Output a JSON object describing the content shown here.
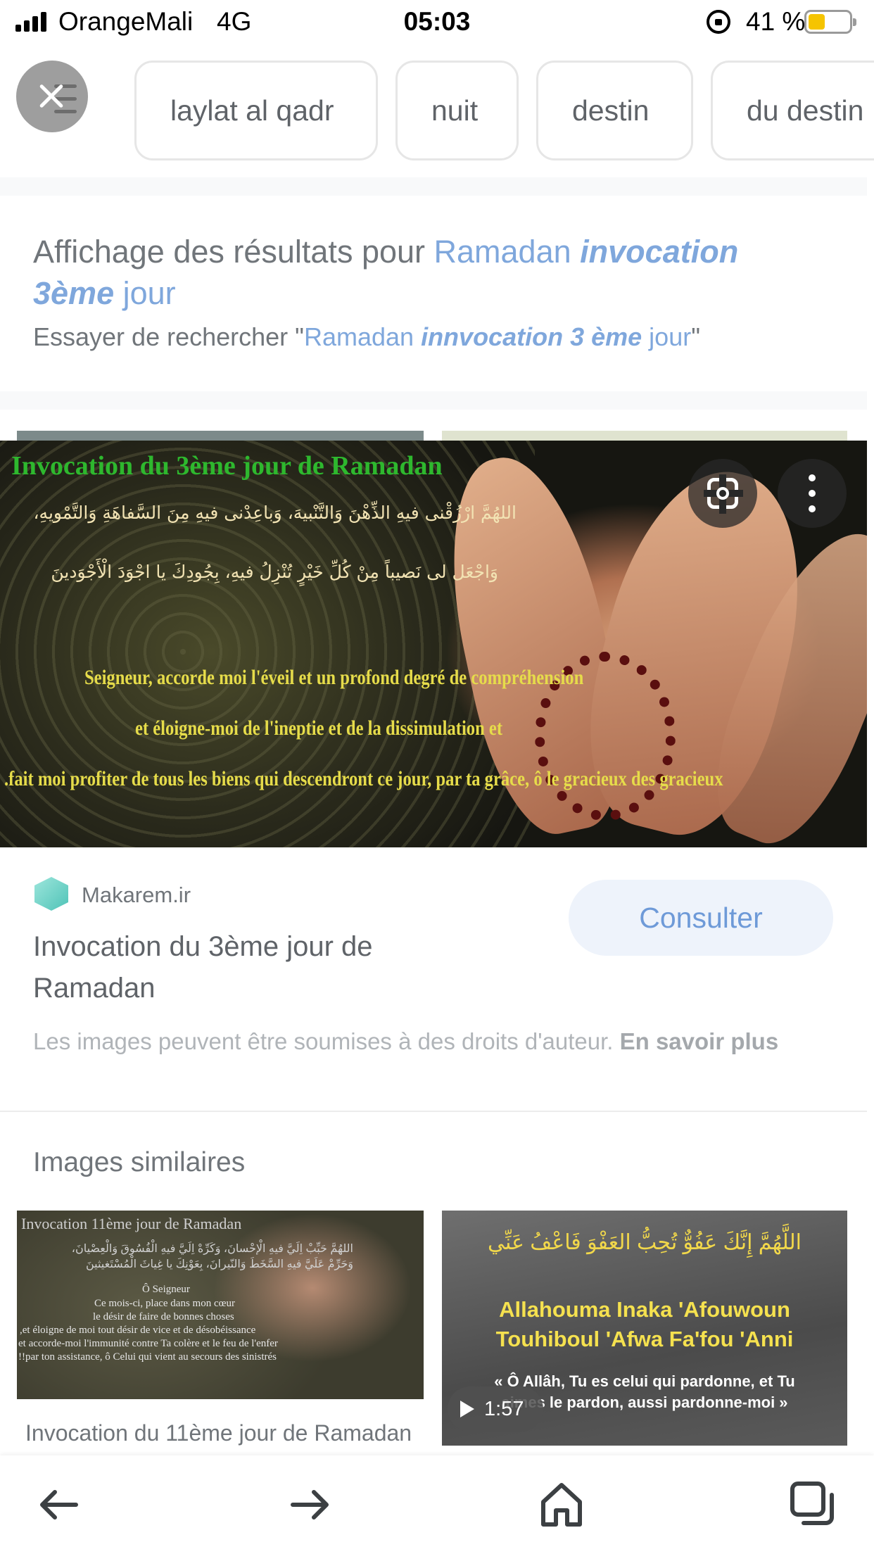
{
  "status_bar": {
    "carrier": "OrangeMali",
    "network": "4G",
    "time": "05:03",
    "battery_percent": "41 %",
    "battery_level": 0.41,
    "icons": [
      "signal-icon",
      "orientation-lock-icon",
      "battery-icon"
    ]
  },
  "chips": {
    "close_icon": "close-filter-icon",
    "items": [
      "laylat al qadr",
      "nuit",
      "destin",
      "du destin"
    ]
  },
  "results": {
    "prefix": "Affichage des résultats pour ",
    "query_word1": "Ramadan",
    "query_em1": "invocation",
    "query_em2": "3ème",
    "query_word2": "jour",
    "suggest_prefix": "Essayer de rechercher \"",
    "suggest_word1": "Ramadan",
    "suggest_em": "innvocation 3 ème",
    "suggest_word2": "jour",
    "suggest_suffix": "\""
  },
  "preview": {
    "image_title": "Invocation du 3ème jour de Ramadan",
    "arabic_line1": "اللهُمَّ ارْزُقْنى فيهِ الذِّهْنَ وَالتَّنْبيهَ، وَباعِدْنى فيهِ مِنَ السَّفاهَةِ وَالتَّمْويهِ،",
    "arabic_line2": "وَاجْعَل لى نَصيباً مِنْ كُلِّ خَيْرٍ تُنْزِلُ فيهِ، بِجُودِكَ يا اجْوَدَ الْأَجْوَدينَ",
    "fr_line1": "Seigneur, accorde moi l'éveil et un profond degré de compréhension",
    "fr_line2": "et éloigne-moi de l'ineptie et de la dissimulation et",
    "fr_line3": ".fait moi profiter de tous les biens qui descendront ce jour, par ta grâce, ô le gracieux des gracieux",
    "lens_icon": "lens-icon",
    "more_icon": "more-vert-icon"
  },
  "source": {
    "name": "Makarem.ir",
    "title": "Invocation du 3ème jour de Ramadan",
    "consult_label": "Consulter",
    "copyright_text": "Les images peuvent être soumises à des droits d'auteur. ",
    "learn_more": "En savoir plus"
  },
  "similar": {
    "heading": "Images similaires",
    "thumb1": {
      "title": "Invocation 11ème jour de Ramadan",
      "arabic": "اللهُمَّ حَبِّبْ اِلَيَّ فيهِ الْإحْسانَ، وَكَرِّهْ اِلَيَّ فيهِ الْفُسُوقَ وَالْعِصْيانَ،",
      "arabic2": "وَحَرِّمْ عَلَيَّ فيهِ السَّخَطَ وَالنّيرانَ، بِعَوْنِكَ يا غِياثَ الْمُسْتَغيثينَ",
      "fr1": "Ô Seigneur",
      "fr2": "Ce mois-ci, place dans mon cœur",
      "fr3": "le désir de faire de bonnes choses",
      "fr4": ",et éloigne de moi tout désir de vice et de désobéissance",
      "fr5": "et accorde-moi l'immunité contre Ta colère et le feu de l'enfer",
      "fr6": "!!par ton assistance, ô Celui qui vient au secours des sinistrés",
      "caption": "Invocation du 11ème jour de Ramadan"
    },
    "thumb2": {
      "arabic": "اللَّهُمَّ إِنَّكَ عَفُوٌّ تُحِبُّ العَفْوَ فَاعْفُ عَنِّي",
      "main1": "Allahouma Inaka 'Afouwoun",
      "main2": "Touhiboul 'Afwa Fa'fou 'Anni",
      "fr1": "« Ô Allâh, Tu es celui qui pardonne, et Tu",
      "fr2": "aimes le pardon, aussi pardonne-moi »",
      "duration": "1:57"
    }
  },
  "bottom_nav": {
    "icons": [
      "back-arrow-icon",
      "forward-arrow-icon",
      "home-icon",
      "tabs-icon"
    ]
  }
}
